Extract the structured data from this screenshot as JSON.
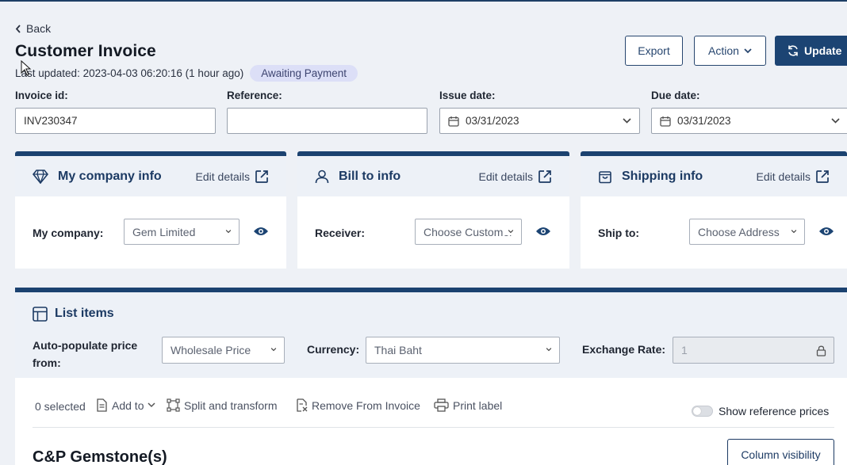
{
  "header": {
    "back_label": "Back",
    "title": "Customer Invoice",
    "last_updated": "Last updated: 2023-04-03 06:20:16 (1 hour ago)",
    "status_badge": "Awaiting Payment"
  },
  "actions": {
    "export_label": "Export",
    "action_label": "Action",
    "update_label": "Update"
  },
  "fields": {
    "invoice_id": {
      "label": "Invoice id:",
      "value": "INV230347"
    },
    "reference": {
      "label": "Reference:",
      "value": ""
    },
    "issue_date": {
      "label": "Issue date:",
      "value": "03/31/2023"
    },
    "due_date": {
      "label": "Due date:",
      "value": "03/31/2023"
    }
  },
  "cards": {
    "company": {
      "title": "My company info",
      "edit": "Edit details",
      "label": "My company:",
      "select": "Gem Limited"
    },
    "bill": {
      "title": "Bill to info",
      "edit": "Edit details",
      "label": "Receiver:",
      "select": "Choose Customer"
    },
    "ship": {
      "title": "Shipping info",
      "edit": "Edit details",
      "label": "Ship to:",
      "select": "Choose Address"
    }
  },
  "list": {
    "title": "List items",
    "auto_label": "Auto-populate price from:",
    "auto_select": "Wholesale Price",
    "currency_label": "Currency:",
    "currency_select": "Thai Baht",
    "exchange_label": "Exchange Rate:",
    "exchange_value": "1",
    "selected": "0 selected",
    "add_to": "Add to",
    "split": "Split and transform",
    "remove": "Remove From Invoice",
    "print": "Print label",
    "show_ref": "Show reference prices",
    "group_title": "C&P Gemstone(s)",
    "column_visibility": "Column visibility"
  },
  "colors": {
    "primary": "#1c4473",
    "badge_bg": "#dcdff7",
    "background": "#eef1f6"
  }
}
